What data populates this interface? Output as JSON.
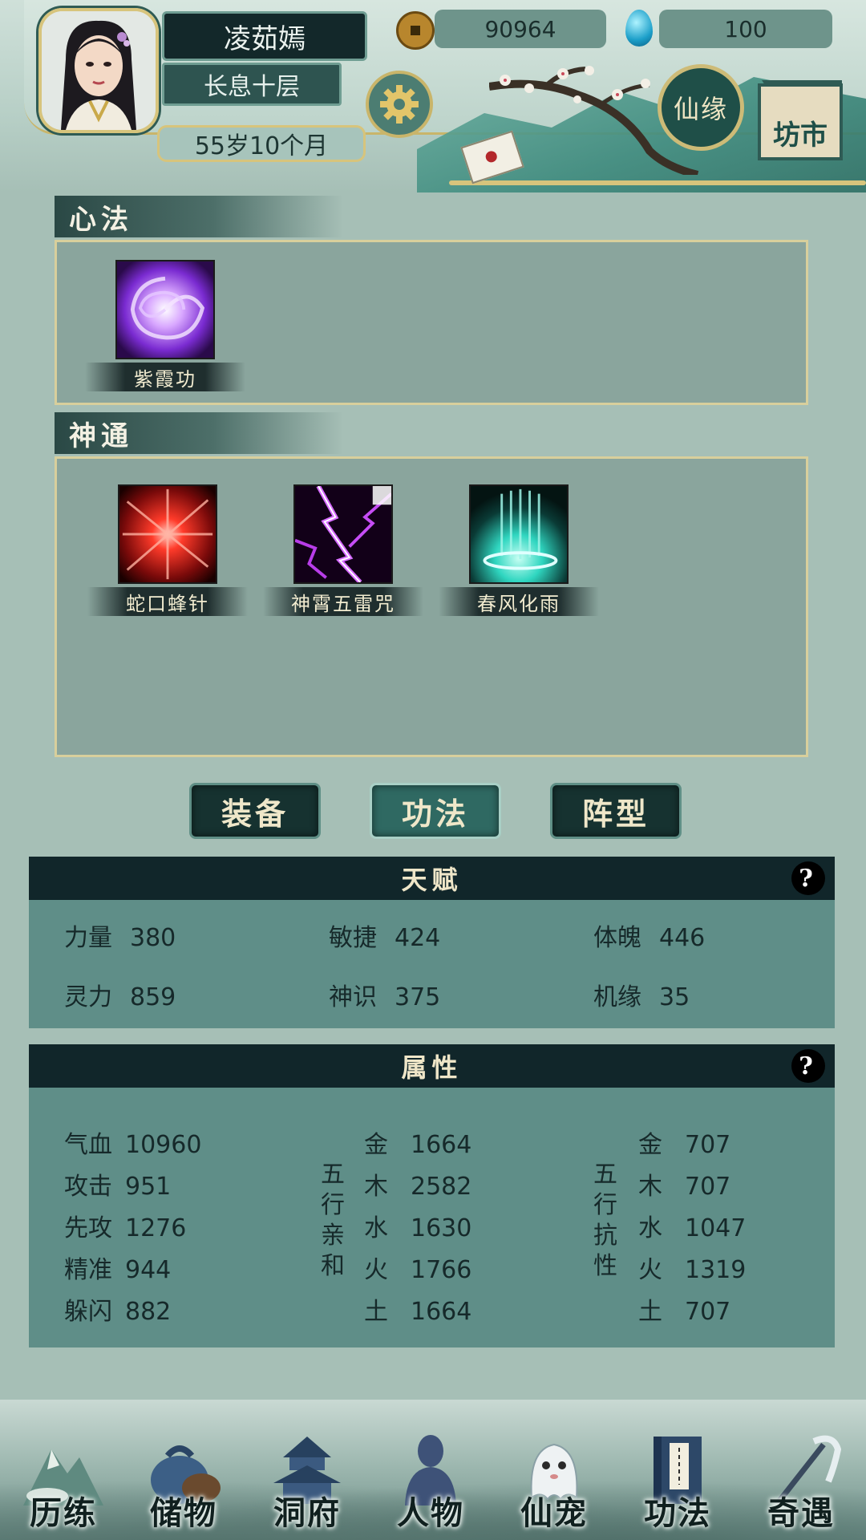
{
  "header": {
    "name": "凌茹嫣",
    "realm": "长息十层",
    "age": "55岁10个月",
    "coins": "90964",
    "gems": "100",
    "xianyuan_label": "仙缘",
    "fangshi_label": "坊市"
  },
  "xinfa": {
    "title": "心法",
    "skills": [
      {
        "name": "紫霞功"
      }
    ]
  },
  "shentong": {
    "title": "神通",
    "skills": [
      {
        "name": "蛇口蜂针"
      },
      {
        "name": "神霄五雷咒"
      },
      {
        "name": "春风化雨"
      }
    ]
  },
  "tabs": [
    {
      "label": "装备"
    },
    {
      "label": "功法",
      "active": true
    },
    {
      "label": "阵型"
    }
  ],
  "talent": {
    "title": "天赋",
    "help": "?",
    "stats": [
      {
        "k": "力量",
        "v": "380"
      },
      {
        "k": "敏捷",
        "v": "424"
      },
      {
        "k": "体魄",
        "v": "446"
      },
      {
        "k": "灵力",
        "v": "859"
      },
      {
        "k": "神识",
        "v": "375"
      },
      {
        "k": "机缘",
        "v": "35"
      }
    ]
  },
  "attributes": {
    "title": "属性",
    "help": "?",
    "base": [
      {
        "k": "气血",
        "v": "10960"
      },
      {
        "k": "攻击",
        "v": "951"
      },
      {
        "k": "先攻",
        "v": "1276"
      },
      {
        "k": "精准",
        "v": "944"
      },
      {
        "k": "躲闪",
        "v": "882"
      }
    ],
    "affinity_label": "五行亲和",
    "affinity": [
      {
        "k": "金",
        "v": "1664"
      },
      {
        "k": "木",
        "v": "2582"
      },
      {
        "k": "水",
        "v": "1630"
      },
      {
        "k": "火",
        "v": "1766"
      },
      {
        "k": "土",
        "v": "1664"
      }
    ],
    "resist_label": "五行抗性",
    "resist": [
      {
        "k": "金",
        "v": "707"
      },
      {
        "k": "木",
        "v": "707"
      },
      {
        "k": "水",
        "v": "1047"
      },
      {
        "k": "火",
        "v": "1319"
      },
      {
        "k": "土",
        "v": "707"
      }
    ]
  },
  "nav": [
    {
      "label": "历练",
      "icon": "mountain-icon"
    },
    {
      "label": "储物",
      "icon": "bag-icon"
    },
    {
      "label": "洞府",
      "icon": "pagoda-icon"
    },
    {
      "label": "人物",
      "icon": "person-icon",
      "active": true
    },
    {
      "label": "仙宠",
      "icon": "ghost-pet-icon"
    },
    {
      "label": "功法",
      "icon": "book-icon"
    },
    {
      "label": "奇遇",
      "icon": "staff-icon"
    }
  ],
  "colors": {
    "background": "#a6bfb6",
    "panel": "#5f8e88",
    "panel_head": "#11262a",
    "gold": "#d7c47c"
  }
}
